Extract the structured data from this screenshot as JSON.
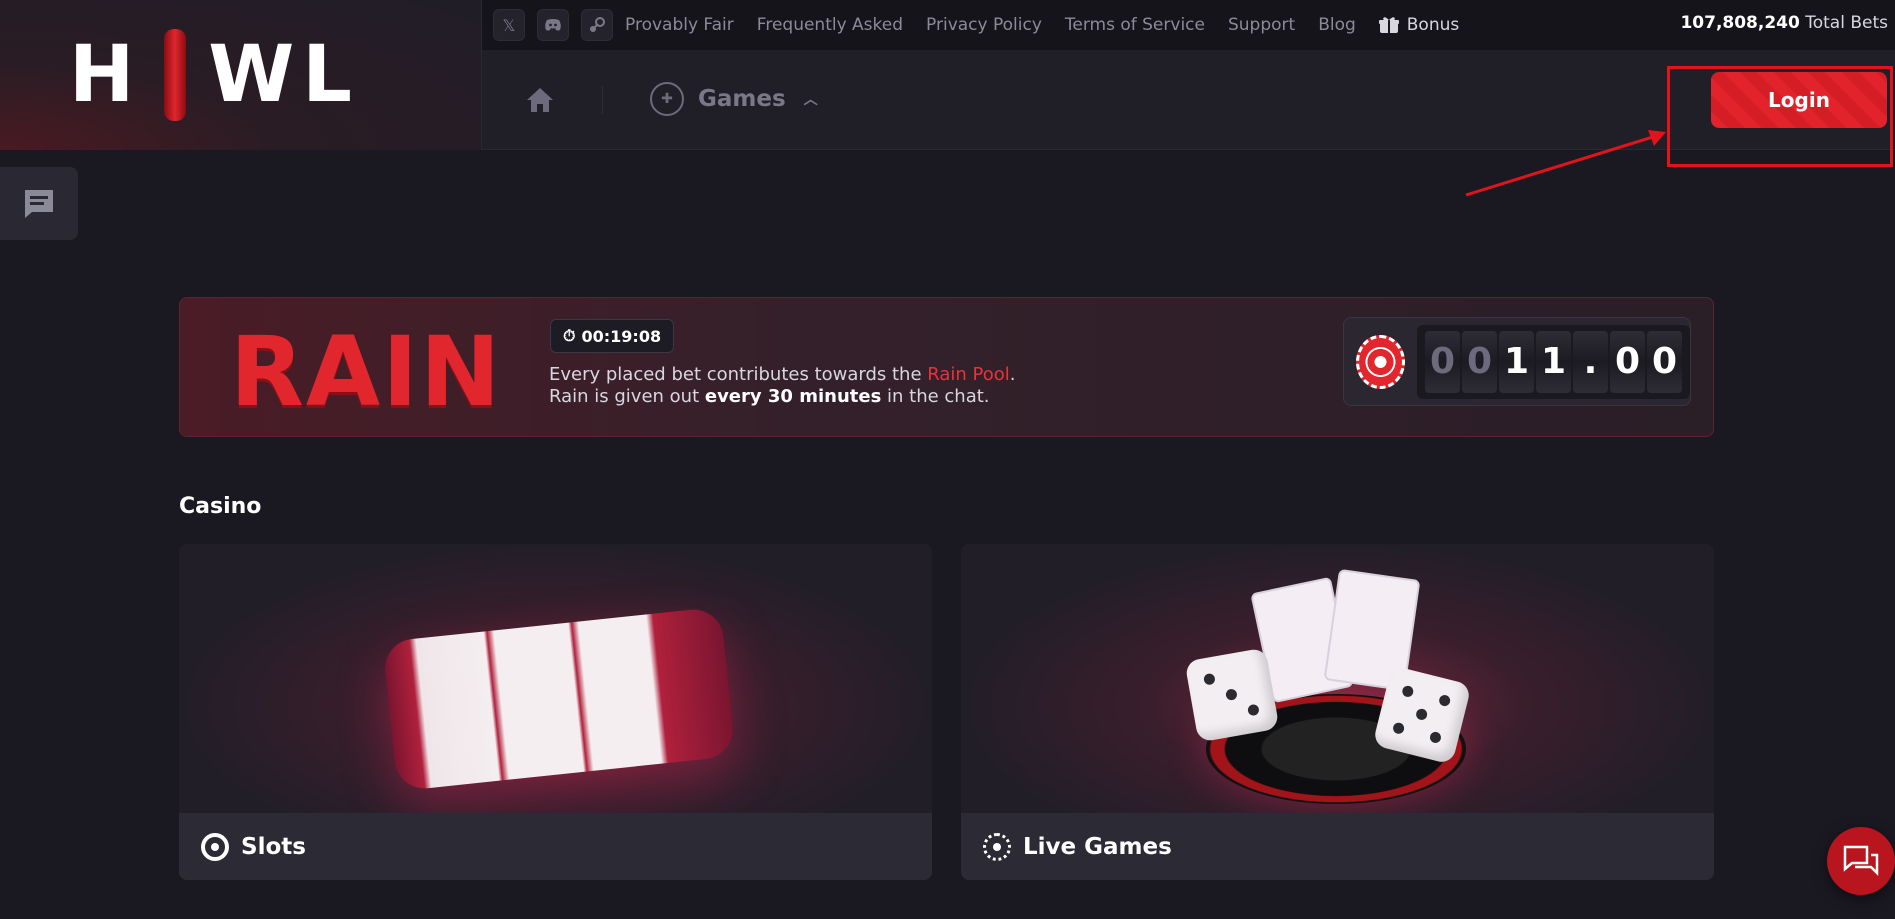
{
  "logo": {
    "left": "H",
    "right": "WL"
  },
  "topbar": {
    "links": [
      "Provably Fair",
      "Frequently Asked",
      "Privacy Policy",
      "Terms of Service",
      "Support",
      "Blog"
    ],
    "bonus_label": "Bonus",
    "total_bets_value": "107,808,240",
    "total_bets_label": "Total Bets",
    "social_icons": [
      "x-icon",
      "discord-icon",
      "steam-icon"
    ]
  },
  "nav": {
    "games_label": "Games",
    "login_label": "Login"
  },
  "rain": {
    "title": "RAIN",
    "timer": "00:19:08",
    "line1_prefix": "Every placed bet contributes towards the ",
    "line1_link": "Rain Pool",
    "line1_suffix": ".",
    "line2_prefix": "Rain is given out ",
    "line2_bold": "every 30 minutes",
    "line2_suffix": " in the chat.",
    "pool_digits": [
      "0",
      "0",
      "1",
      "1",
      ".",
      "0",
      "0"
    ]
  },
  "casino": {
    "title": "Casino",
    "cards": [
      {
        "label": "Slots"
      },
      {
        "label": "Live Games"
      }
    ]
  },
  "colors": {
    "accent": "#e2232b",
    "background": "#1a1922"
  }
}
